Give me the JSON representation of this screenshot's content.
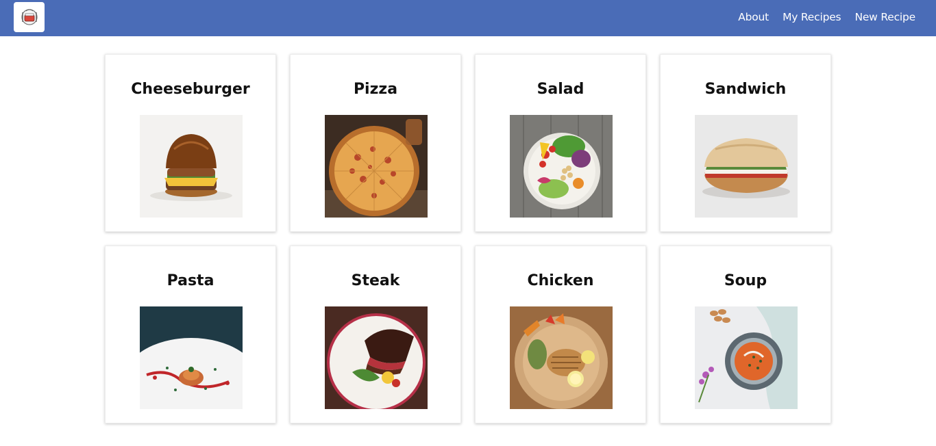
{
  "navbar": {
    "logo_icon": "recipe-book-logo-icon",
    "links": [
      {
        "label": "About"
      },
      {
        "label": "My Recipes"
      },
      {
        "label": "New Recipe"
      }
    ],
    "background_color": "#4a6cb7"
  },
  "recipes": [
    {
      "name": "Cheeseburger",
      "icon": "cheeseburger-photo"
    },
    {
      "name": "Pizza",
      "icon": "pizza-photo"
    },
    {
      "name": "Salad",
      "icon": "salad-photo"
    },
    {
      "name": "Sandwich",
      "icon": "sandwich-photo"
    },
    {
      "name": "Pasta",
      "icon": "pasta-photo"
    },
    {
      "name": "Steak",
      "icon": "steak-photo"
    },
    {
      "name": "Chicken",
      "icon": "chicken-photo"
    },
    {
      "name": "Soup",
      "icon": "soup-photo"
    }
  ]
}
